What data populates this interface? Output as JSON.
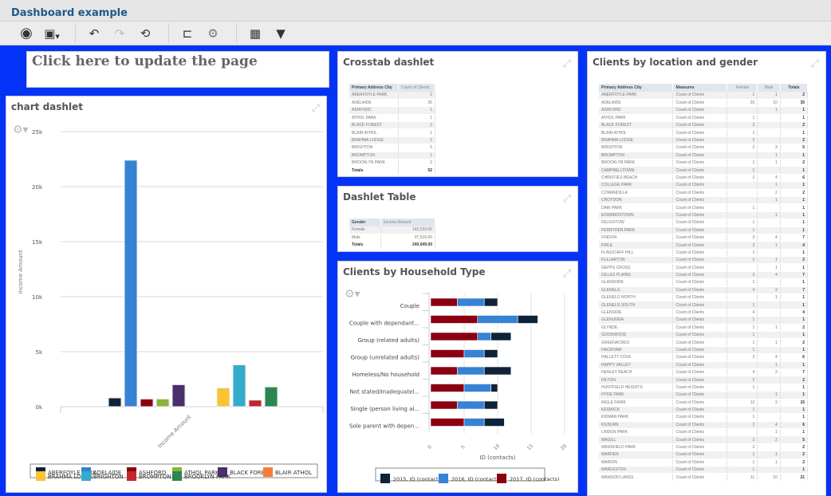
{
  "app": {
    "title": "Dashboard example"
  },
  "toolbar": {
    "groups": [
      [
        {
          "name": "view-icon",
          "glyph": "👁"
        },
        {
          "name": "save-icon",
          "glyph": "💾"
        }
      ],
      [
        {
          "name": "undo-icon",
          "glyph": "↶"
        },
        {
          "name": "redo-icon",
          "glyph": "↷"
        },
        {
          "name": "reset-icon",
          "glyph": "⟲"
        }
      ],
      [
        {
          "name": "hierarchy-icon",
          "glyph": "⊏"
        },
        {
          "name": "settings-icon",
          "glyph": "⚙"
        }
      ],
      [
        {
          "name": "grid-icon",
          "glyph": "▦"
        },
        {
          "name": "filter-icon",
          "glyph": "⏷"
        }
      ]
    ]
  },
  "update_link": "Click here to update the page",
  "chart_dashlet": {
    "title": "chart dashlet",
    "chart_data": {
      "type": "bar",
      "title": "",
      "xlabel": "",
      "ylabel": "Income Amount",
      "ylim": [
        0,
        25000
      ],
      "yticks": [
        "0k",
        "5k",
        "10k",
        "15k",
        "20k",
        "25k"
      ],
      "categories": [
        "Income Amount"
      ],
      "series": [
        {
          "name": "ABERFOYLE PARK",
          "color": "#0e2338",
          "values": [
            800
          ]
        },
        {
          "name": "ADELAIDE",
          "color": "#3682d4",
          "values": [
            22400
          ]
        },
        {
          "name": "ASHFORD",
          "color": "#8b0011",
          "values": [
            700
          ]
        },
        {
          "name": "ATHOL PARK",
          "color": "#8ab439",
          "values": [
            700
          ]
        },
        {
          "name": "BLACK FOREST",
          "color": "#4a2f6b",
          "values": [
            2000
          ]
        },
        {
          "name": "BLAIR ATHOL",
          "color": "#f77c3a",
          "values": [
            0
          ]
        },
        {
          "name": "BRAHMA LODGE",
          "color": "#f9c333",
          "values": [
            1700
          ]
        },
        {
          "name": "BRIGHTON",
          "color": "#33abcb",
          "values": [
            3800
          ]
        },
        {
          "name": "BROMPTON",
          "color": "#c3262f",
          "values": [
            600
          ]
        },
        {
          "name": "BROOKLYN PARK",
          "color": "#2a8751",
          "values": [
            1800
          ]
        }
      ],
      "legend_position": "bottom"
    }
  },
  "crosstab": {
    "title": "Crosstab dashlet",
    "headers": [
      "Primary Address City",
      "Count of Clients"
    ],
    "rows": [
      [
        "ABERFOYLE PARK",
        "2"
      ],
      [
        "ADELAIDE",
        "35"
      ],
      [
        "ASHFORD",
        "1"
      ],
      [
        "ATHOL PARK",
        "1"
      ],
      [
        "BLACK FOREST",
        "2"
      ],
      [
        "BLAIR ATHOL",
        "1"
      ],
      [
        "BRAHMA LODGE",
        "2"
      ],
      [
        "BRIGHTON",
        "5"
      ],
      [
        "BROMPTON",
        "1"
      ],
      [
        "BROOKLYN PARK",
        "2"
      ]
    ],
    "totals": [
      "Totals",
      "52"
    ]
  },
  "dashlet_table": {
    "title": "Dashlet Table",
    "headers": [
      "Gender",
      "Income Amount"
    ],
    "rows": [
      [
        "Female",
        "142,533.00"
      ],
      [
        "Male",
        "97,516.00"
      ]
    ],
    "totals": [
      "Totals",
      "240,049.00"
    ]
  },
  "household": {
    "title": "Clients by Household Type",
    "chart_data": {
      "type": "bar",
      "orientation": "horizontal",
      "stacked": true,
      "xlabel": "ID (contacts)",
      "ylabel": "",
      "xlim": [
        0,
        20
      ],
      "xticks": [
        "0",
        "5",
        "10",
        "15",
        "20"
      ],
      "categories": [
        "Couple",
        "Couple with dependant...",
        "Group (related adults)",
        "Group (unrelated adults)",
        "Homeless/No household",
        "Not stated/Inadequatel...",
        "Single (person living al...",
        "Sole parent with depen..."
      ],
      "series": [
        {
          "name": "2017, ID (contacts)",
          "color": "#8b0011",
          "values": [
            4,
            7,
            7,
            5,
            4,
            5,
            4,
            5
          ]
        },
        {
          "name": "2016, ID (contacts)",
          "color": "#3682d4",
          "values": [
            4,
            6,
            2,
            3,
            4,
            4,
            4,
            3
          ]
        },
        {
          "name": "2015, ID (contacts)",
          "color": "#0e2338",
          "values": [
            2,
            3,
            3,
            2,
            4,
            1,
            2,
            3
          ]
        }
      ],
      "legend": [
        "2015, ID (contacts)",
        "2016, ID (contacts)",
        "2017, ID (contacts)"
      ],
      "legend_position": "bottom"
    }
  },
  "location": {
    "title": "Clients by location and gender",
    "headers": [
      "Primary Address City",
      "Measures",
      "Female",
      "Male",
      "Totals"
    ],
    "rows": [
      [
        "ABERFOYLE PARK",
        "Count of Clients",
        "1",
        "1",
        "2"
      ],
      [
        "ADELAIDE",
        "Count of Clients",
        "25",
        "10",
        "35"
      ],
      [
        "ASHFORD",
        "Count of Clients",
        "",
        "1",
        "1"
      ],
      [
        "ATHOL PARK",
        "Count of Clients",
        "1",
        "",
        "1"
      ],
      [
        "BLACK FOREST",
        "Count of Clients",
        "2",
        "",
        "2"
      ],
      [
        "BLAIR ATHOL",
        "Count of Clients",
        "1",
        "",
        "1"
      ],
      [
        "BRAHMA LODGE",
        "Count of Clients",
        "2",
        "",
        "2"
      ],
      [
        "BRIGHTON",
        "Count of Clients",
        "2",
        "3",
        "5"
      ],
      [
        "BROMPTON",
        "Count of Clients",
        "",
        "1",
        "1"
      ],
      [
        "BROOKLYN PARK",
        "Count of Clients",
        "1",
        "1",
        "2"
      ],
      [
        "CAMPBELLTOWN",
        "Count of Clients",
        "1",
        "",
        "1"
      ],
      [
        "CHRISTIES BEACH",
        "Count of Clients",
        "2",
        "4",
        "6"
      ],
      [
        "COLLEGE PARK",
        "Count of Clients",
        "",
        "1",
        "1"
      ],
      [
        "COWANDILLA",
        "Count of Clients",
        "",
        "2",
        "2"
      ],
      [
        "CROYDON",
        "Count of Clients",
        "",
        "1",
        "1"
      ],
      [
        "DAW PARK",
        "Count of Clients",
        "1",
        "",
        "1"
      ],
      [
        "EDWARDSTOWN",
        "Count of Clients",
        "",
        "1",
        "1"
      ],
      [
        "FELIXSTOW",
        "Count of Clients",
        "1",
        "",
        "1"
      ],
      [
        "FERRYDEN PARK",
        "Count of Clients",
        "1",
        "",
        "1"
      ],
      [
        "FINDON",
        "Count of Clients",
        "3",
        "4",
        "7"
      ],
      [
        "FIRLE",
        "Count of Clients",
        "3",
        "1",
        "4"
      ],
      [
        "FLAGSTAFF HILL",
        "Count of Clients",
        "1",
        "",
        "1"
      ],
      [
        "FULLARTON",
        "Count of Clients",
        "1",
        "1",
        "2"
      ],
      [
        "GEPPS CROSS",
        "Count of Clients",
        "",
        "1",
        "1"
      ],
      [
        "GILLES PLAINS",
        "Count of Clients",
        "3",
        "4",
        "7"
      ],
      [
        "GLANDORE",
        "Count of Clients",
        "1",
        "",
        "1"
      ],
      [
        "GLENELG",
        "Count of Clients",
        "4",
        "3",
        "7"
      ],
      [
        "GLENELG NORTH",
        "Count of Clients",
        "",
        "1",
        "1"
      ],
      [
        "GLENELG SOUTH",
        "Count of Clients",
        "1",
        "",
        "1"
      ],
      [
        "GLENSIDE",
        "Count of Clients",
        "4",
        "",
        "4"
      ],
      [
        "GLENUNGA",
        "Count of Clients",
        "1",
        "",
        "1"
      ],
      [
        "GLYNDE",
        "Count of Clients",
        "1",
        "1",
        "2"
      ],
      [
        "GOODWOOD",
        "Count of Clients",
        "1",
        "",
        "1"
      ],
      [
        "GREENACRES",
        "Count of Clients",
        "1",
        "1",
        "2"
      ],
      [
        "HACKHAM",
        "Count of Clients",
        "1",
        "",
        "1"
      ],
      [
        "HALLETT COVE",
        "Count of Clients",
        "2",
        "4",
        "6"
      ],
      [
        "HAPPY VALLEY",
        "Count of Clients",
        "",
        "1",
        "1"
      ],
      [
        "HENLEY BEACH",
        "Count of Clients",
        "4",
        "3",
        "7"
      ],
      [
        "HILTON",
        "Count of Clients",
        "2",
        "",
        "2"
      ],
      [
        "HUNTFIELD HEIGHTS",
        "Count of Clients",
        "1",
        "",
        "1"
      ],
      [
        "HYDE PARK",
        "Count of Clients",
        "",
        "1",
        "1"
      ],
      [
        "INGLE FARM",
        "Count of Clients",
        "12",
        "3",
        "15"
      ],
      [
        "KESWICK",
        "Count of Clients",
        "1",
        "",
        "1"
      ],
      [
        "KIDMAN PARK",
        "Count of Clients",
        "1",
        "",
        "1"
      ],
      [
        "KILBURN",
        "Count of Clients",
        "2",
        "4",
        "6"
      ],
      [
        "LINDEN PARK",
        "Count of Clients",
        "",
        "1",
        "1"
      ],
      [
        "MAGILL",
        "Count of Clients",
        "3",
        "2",
        "5"
      ],
      [
        "MANSFIELD PARK",
        "Count of Clients",
        "2",
        "",
        "2"
      ],
      [
        "MARDEN",
        "Count of Clients",
        "1",
        "1",
        "2"
      ],
      [
        "MARION",
        "Count of Clients",
        "1",
        "1",
        "2"
      ],
      [
        "MARLESTON",
        "Count of Clients",
        "1",
        "",
        "1"
      ],
      [
        "MAWSON LAKES",
        "Count of Clients",
        "11",
        "10",
        "21"
      ]
    ]
  }
}
